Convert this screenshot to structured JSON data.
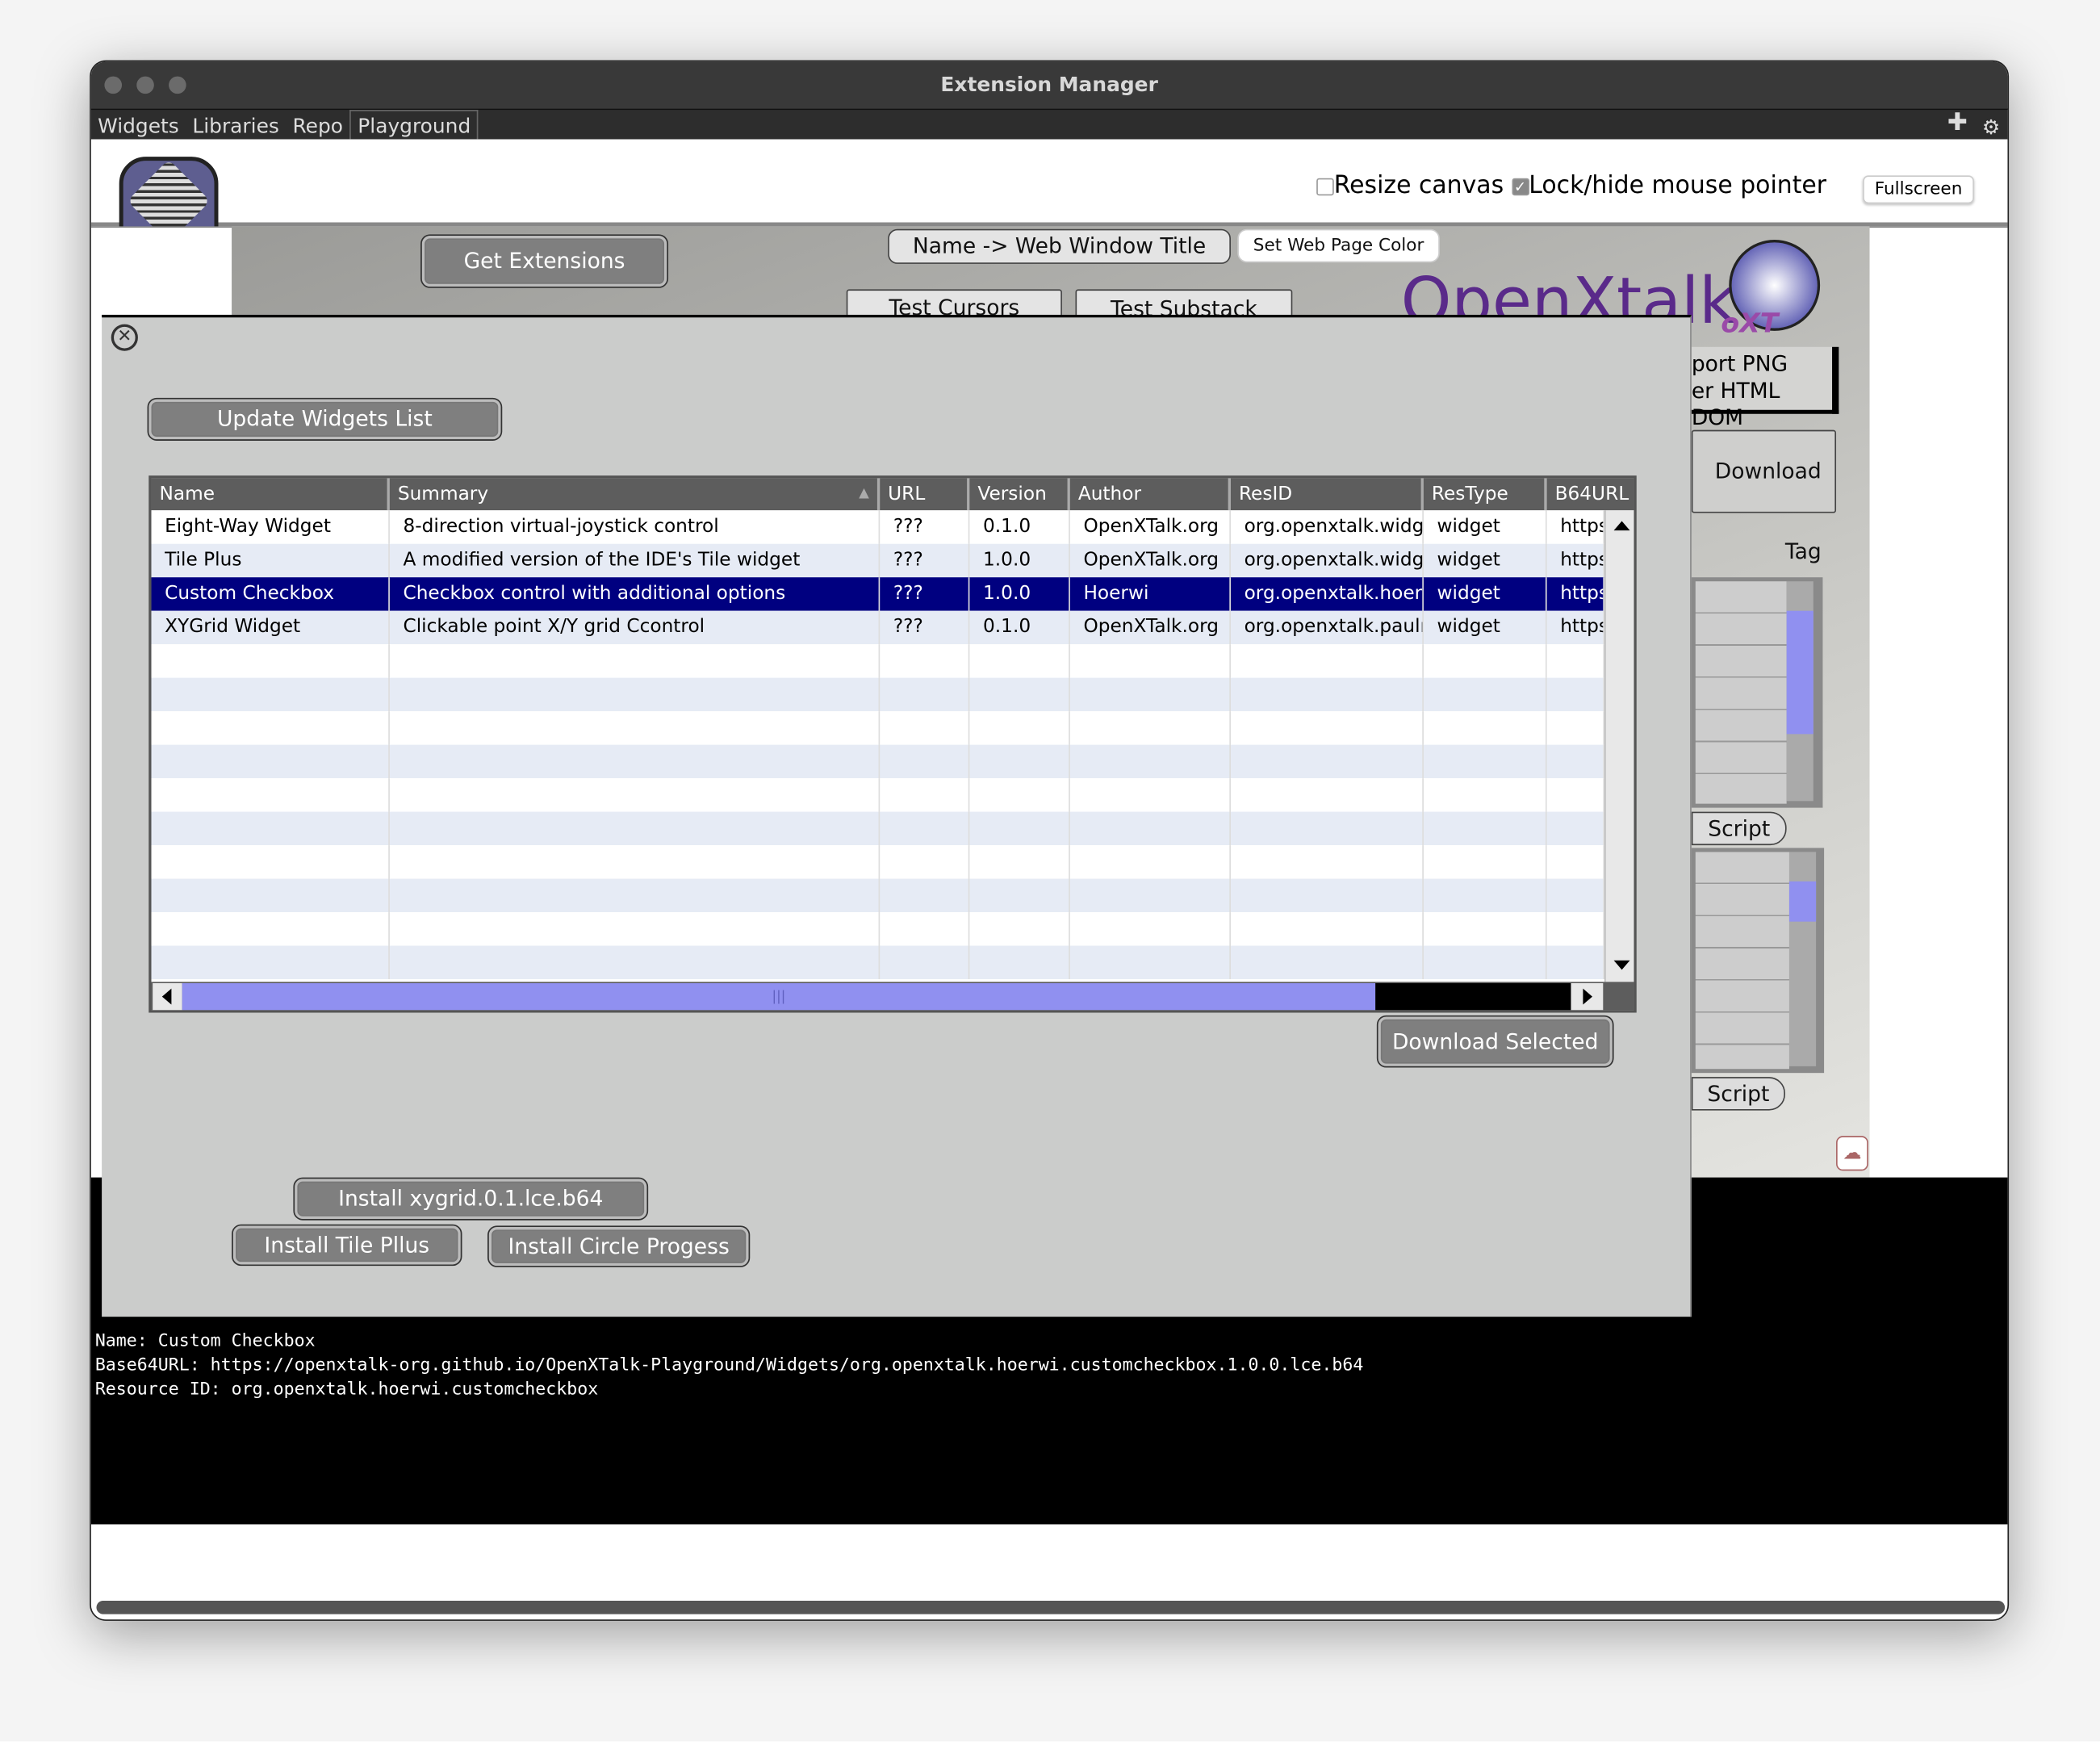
{
  "window": {
    "title": "Extension Manager"
  },
  "menubar": {
    "items": [
      "Widgets",
      "Libraries",
      "Repo",
      "Playground"
    ],
    "selected": "Playground",
    "icons": [
      "plus-icon",
      "gear-icon"
    ]
  },
  "toolbar": {
    "resize_canvas_label": "Resize canvas",
    "resize_canvas_checked": false,
    "lock_mouse_label": "Lock/hide mouse pointer",
    "lock_mouse_checked": true,
    "fullscreen_label": "Fullscreen"
  },
  "stack": {
    "get_extensions": "Get Extensions",
    "name_to_title": "Name -> Web Window Title",
    "set_color": "Set Web Page Color",
    "test_cursors": "Test Cursors",
    "test_substack": "Test Substack",
    "brand": "OpenXtalk",
    "brand_badge": "oXT",
    "export_png": "port PNG",
    "html_dom": "er HTML DOM",
    "download_tag": "Download Tag",
    "script1": "Script",
    "script2": "Script"
  },
  "dialog": {
    "update_button": "Update Widgets List",
    "columns": [
      "Name",
      "Summary",
      "URL",
      "Version",
      "Author",
      "ResID",
      "ResType",
      "B64URL"
    ],
    "sort_column": "Summary",
    "rows": [
      [
        "Eight-Way Widget",
        "8-direction virtual-joystick control",
        "???",
        "0.1.0",
        "OpenXTalk.org",
        "org.openxtalk.widge",
        "widget",
        "https"
      ],
      [
        "Tile Plus",
        "A modified version of the IDE's Tile widget",
        "???",
        "1.0.0",
        "OpenXTalk.org",
        "org.openxtalk.widge",
        "widget",
        "https"
      ],
      [
        "Custom Checkbox",
        "Checkbox control with additional options",
        "???",
        "1.0.0",
        "Hoerwi",
        "org.openxtalk.hoerw",
        "widget",
        "https"
      ],
      [
        "XYGrid Widget",
        "Clickable point X/Y grid Ccontrol",
        "???",
        "0.1.0",
        "OpenXTalk.org",
        "org.openxtalk.paulm",
        "widget",
        "https"
      ]
    ],
    "selected_row": 2,
    "download_selected": "Download Selected",
    "install_xygrid": "Install xygrid.0.1.lce.b64",
    "install_tile": "Install Tile Pllus",
    "install_circle": "Install Circle Progess"
  },
  "console": {
    "lines": [
      "Name: Custom Checkbox",
      "Base64URL: https://openxtalk-org.github.io/OpenXTalk-Playground/Widgets/org.openxtalk.hoerwi.customcheckbox.1.0.0.lce.b64",
      "Resource ID: org.openxtalk.hoerwi.customcheckbox"
    ]
  },
  "colors": {
    "selection": "#000080",
    "scroll_thumb": "#9090f0",
    "brand": "#5a2a8a"
  }
}
